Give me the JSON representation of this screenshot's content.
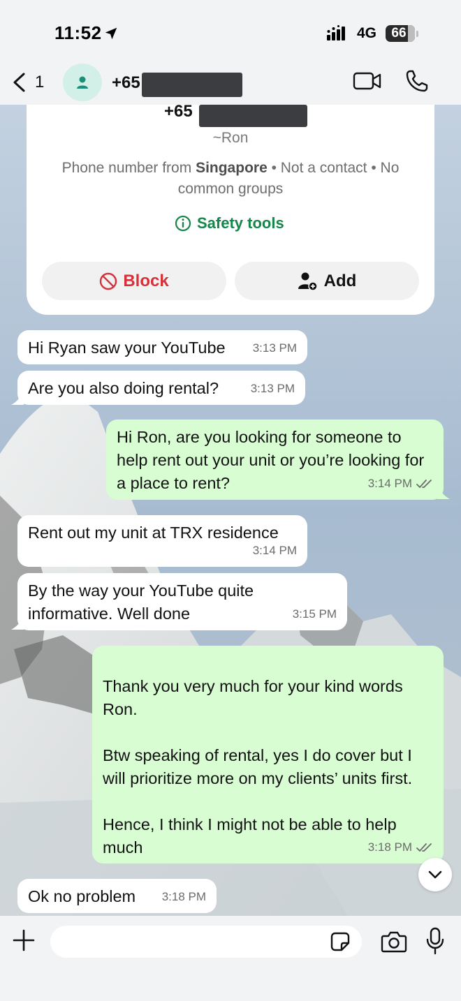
{
  "status_bar": {
    "time": "11:52",
    "network": "4G",
    "battery": "66",
    "battery_level": 0.66
  },
  "header": {
    "back_count": "1",
    "contact_prefix": "+65"
  },
  "contact_card": {
    "number_prefix": "+65",
    "alias": "~Ron",
    "info_prefix": "Phone number from ",
    "info_country": "Singapore",
    "info_suffix": " • Not a contact • No common groups",
    "safety_tools_label": "Safety tools",
    "block_label": "Block",
    "add_label": "Add"
  },
  "messages": [
    {
      "direction": "in",
      "text": "Hi Ryan saw your YouTube",
      "time": "3:13 PM"
    },
    {
      "direction": "in",
      "text": "Are you also doing rental?",
      "time": "3:13 PM"
    },
    {
      "direction": "out",
      "text": "Hi Ron, are you looking for someone to help rent out your unit or you’re looking for a place to rent?",
      "time": "3:14 PM",
      "status": "read"
    },
    {
      "direction": "in",
      "text": "Rent out my unit at TRX residence",
      "time": "3:14 PM"
    },
    {
      "direction": "in",
      "text": "By the way your YouTube quite informative. Well done",
      "time": "3:15 PM"
    },
    {
      "direction": "out",
      "text": "Thank you very much for your kind words Ron.\n\nBtw speaking of rental, yes I do cover but I will prioritize more on my clients’ units first.\n\nHence, I think I might not be able to help much",
      "time": "3:18 PM",
      "status": "read"
    },
    {
      "direction": "in",
      "text": "Ok no problem",
      "time": "3:18 PM"
    }
  ],
  "colors": {
    "outgoing_bubble": "#d9fdd3",
    "incoming_bubble": "#ffffff",
    "accent_green": "#15864a",
    "block_red": "#d8303a",
    "read_ticks": "#6b6b6b"
  },
  "icons": {
    "location": "location-arrow-icon",
    "signal": "signal-icon",
    "back": "chevron-left-icon",
    "avatar": "person-icon",
    "video": "video-camera-icon",
    "call": "phone-icon",
    "info": "info-icon",
    "block": "block-icon",
    "add": "add-person-icon",
    "scroll": "chevron-down-icon",
    "plus": "plus-icon",
    "sticker": "sticker-icon",
    "camera": "camera-icon",
    "mic": "microphone-icon"
  }
}
